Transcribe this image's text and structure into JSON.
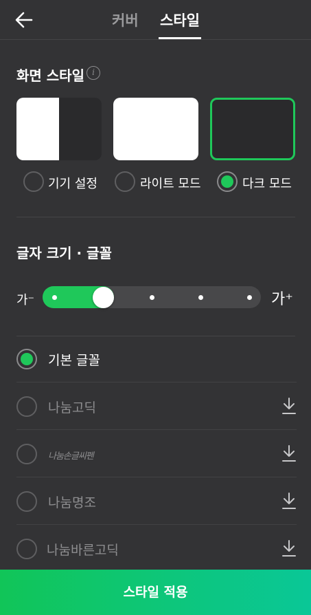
{
  "header": {
    "tabs": [
      {
        "label": "커버",
        "active": false
      },
      {
        "label": "스타일",
        "active": true
      }
    ]
  },
  "screen_style": {
    "title": "화면 스타일",
    "info_icon": "i",
    "options": [
      {
        "label": "기기 설정",
        "selected": false
      },
      {
        "label": "라이트 모드",
        "selected": false
      },
      {
        "label": "다크 모드",
        "selected": true
      }
    ]
  },
  "font_section": {
    "title": "글자 크기 · 글꼴",
    "size_small_label": "가⁻",
    "size_large_label": "가⁺",
    "size_level": 2,
    "size_levels_total": 5,
    "fonts": [
      {
        "name": "기본 글꼴",
        "selected": true,
        "downloadable": false
      },
      {
        "name": "나눔고딕",
        "selected": false,
        "downloadable": true
      },
      {
        "name": "나눔손글씨펜",
        "selected": false,
        "downloadable": true
      },
      {
        "name": "나눔명조",
        "selected": false,
        "downloadable": true
      },
      {
        "name": "나눔바른고딕",
        "selected": false,
        "downloadable": true
      }
    ]
  },
  "footer": {
    "apply_label": "스타일 적용"
  },
  "colors": {
    "background": "#333335",
    "accent": "#1fc85a",
    "apply_gradient_end": "#0ac797"
  }
}
